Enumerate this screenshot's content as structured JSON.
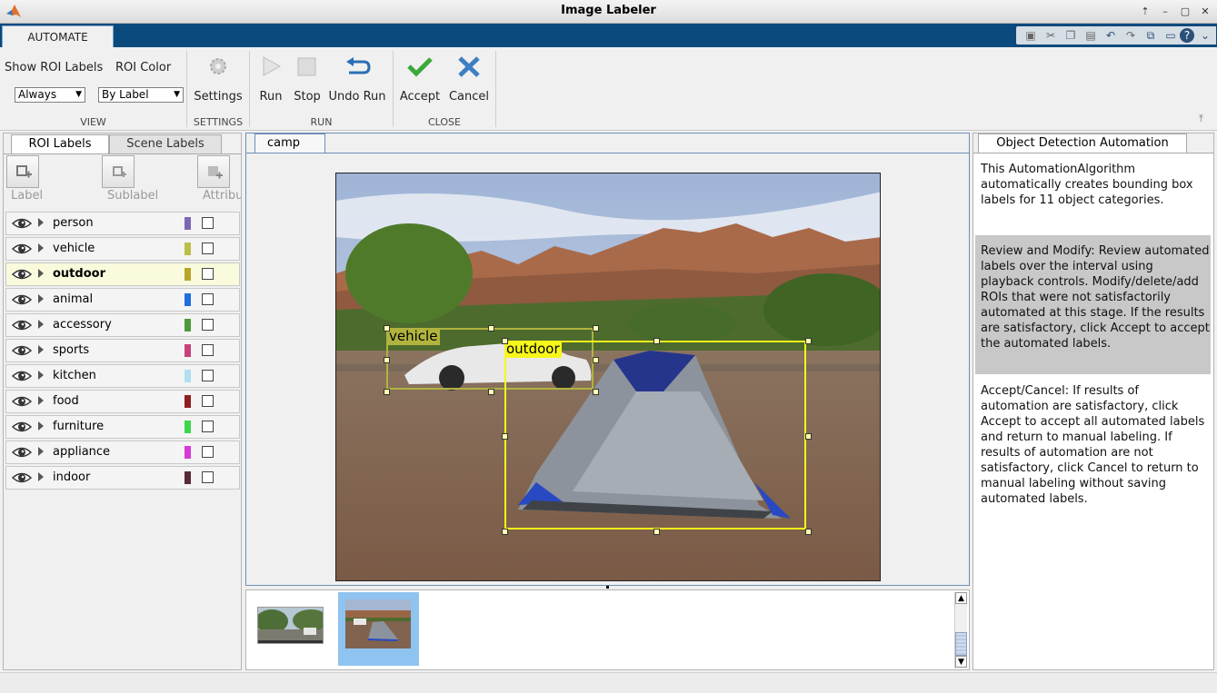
{
  "window": {
    "title": "Image Labeler"
  },
  "tabs": {
    "automate": "AUTOMATE"
  },
  "toolstrip": {
    "view": {
      "show_roi_labels": "Show ROI Labels",
      "roi_color": "ROI Color",
      "show_value": "Always",
      "color_value": "By Label",
      "section": "VIEW"
    },
    "settings": {
      "settings_label": "Settings",
      "section": "SETTINGS"
    },
    "run": {
      "run_label": "Run",
      "stop_label": "Stop",
      "undo_label": "Undo Run",
      "section": "RUN"
    },
    "close": {
      "accept_label": "Accept",
      "cancel_label": "Cancel",
      "section": "CLOSE"
    }
  },
  "left_panel": {
    "tab_roi": "ROI Labels",
    "tab_scene": "Scene Labels",
    "btn_label": "Label",
    "btn_sublabel": "Sublabel",
    "btn_attribute": "Attribu",
    "labels": [
      {
        "name": "person",
        "color": "#7b68b5"
      },
      {
        "name": "vehicle",
        "color": "#bcbf47"
      },
      {
        "name": "outdoor",
        "color": "#b8a52a"
      },
      {
        "name": "animal",
        "color": "#1f6fe0"
      },
      {
        "name": "accessory",
        "color": "#4e9a3a"
      },
      {
        "name": "sports",
        "color": "#c8417a"
      },
      {
        "name": "kitchen",
        "color": "#b0def0"
      },
      {
        "name": "food",
        "color": "#8f1f1f"
      },
      {
        "name": "furniture",
        "color": "#3fd64a"
      },
      {
        "name": "appliance",
        "color": "#d83ad8"
      },
      {
        "name": "indoor",
        "color": "#5a2a36"
      }
    ]
  },
  "center": {
    "image_tab": "camp",
    "rois": {
      "vehicle": "vehicle",
      "outdoor": "outdoor"
    }
  },
  "right_panel": {
    "tab": "Object Detection Automation",
    "description": "This AutomationAlgorithm automatically creates bounding box labels for 11 object categories.",
    "review": "Review and Modify: Review automated labels over the interval using playback controls. Modify/delete/add ROIs that were not satisfactorily automated at this stage. If the results are satisfactory, click Accept to accept the automated labels.",
    "accept_cancel": "Accept/Cancel: If results of automation are satisfactory, click Accept to accept all automated labels and return to manual labeling. If results of automation are not satisfactory, click Cancel to return to manual labeling without saving automated labels."
  }
}
